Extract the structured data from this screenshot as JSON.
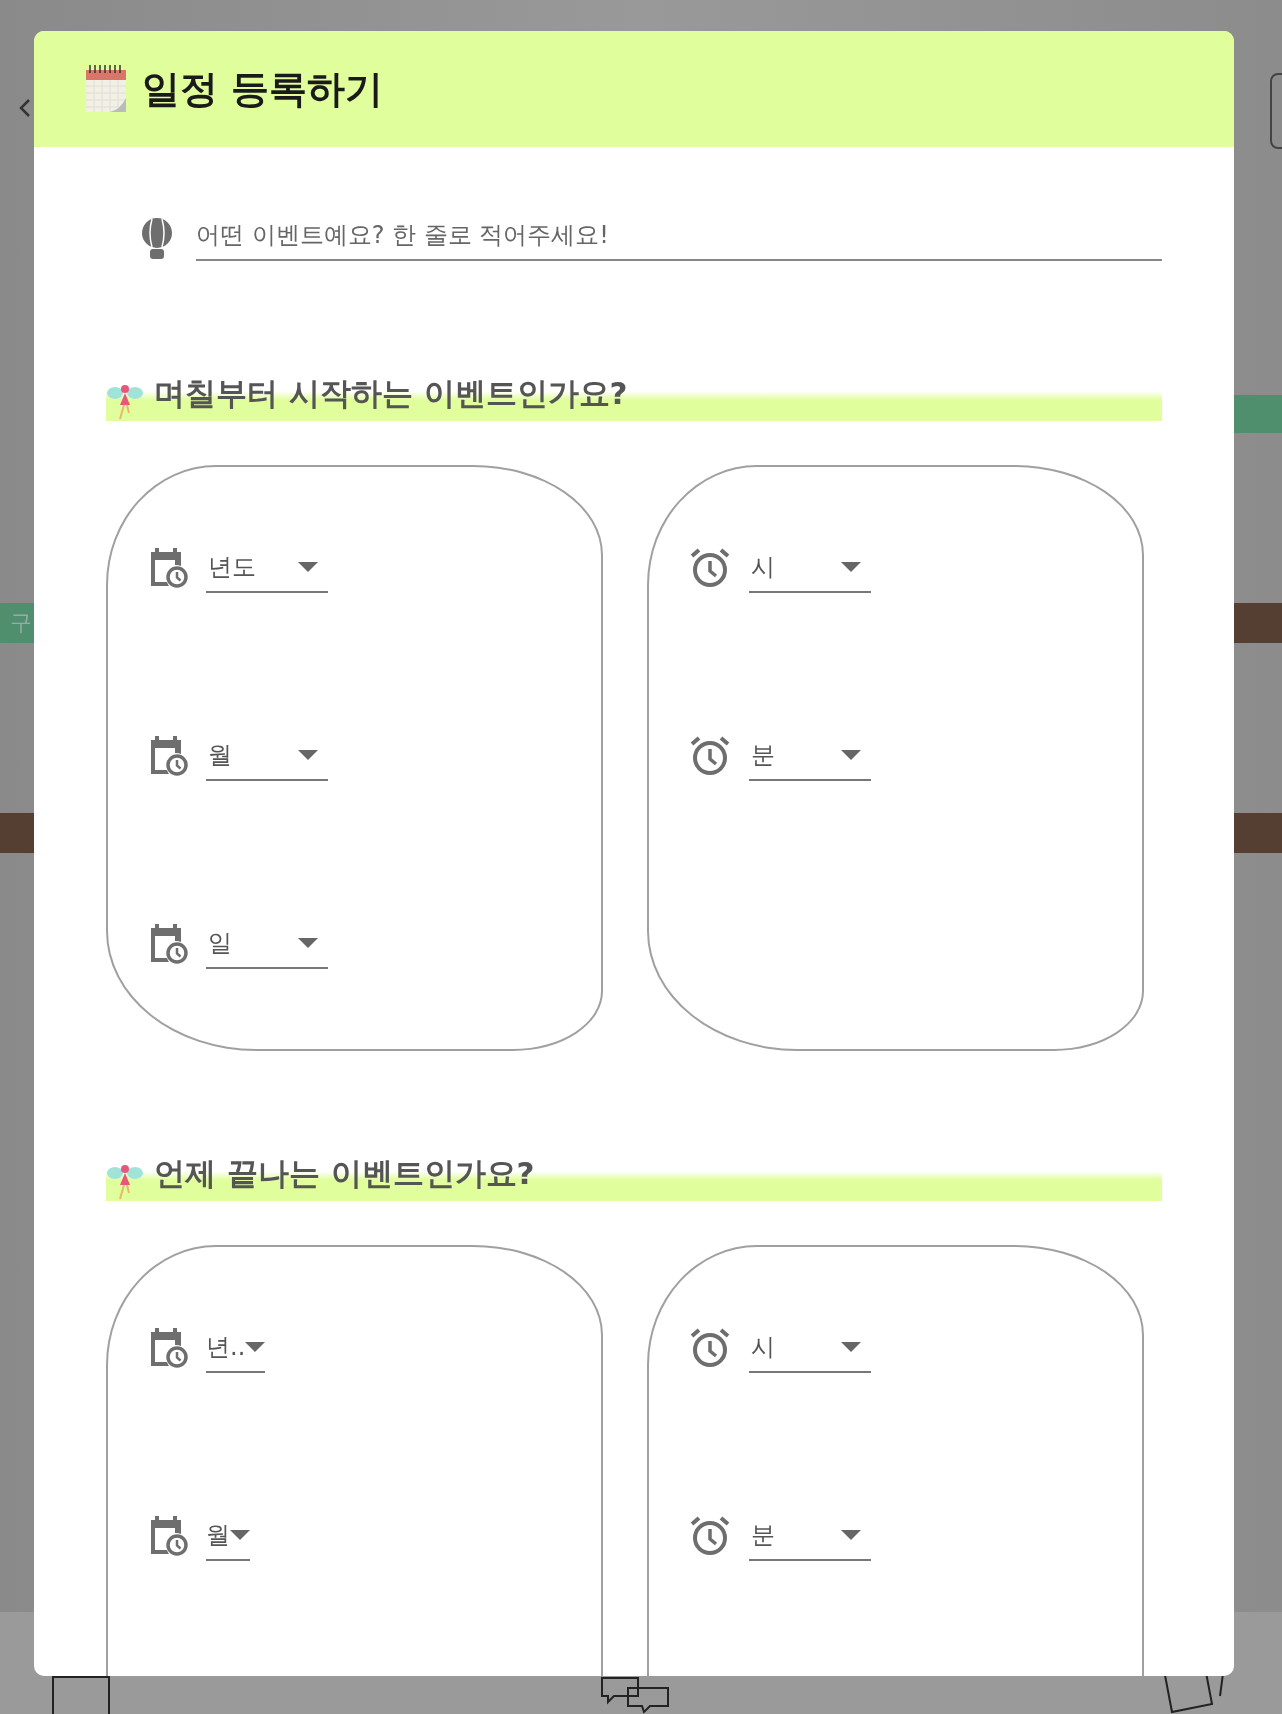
{
  "background_page": {
    "tag_label": "구"
  },
  "dialog": {
    "title": "일정 등록하기",
    "event_input": {
      "placeholder": "어떤 이벤트예요? 한 줄로 적어주세요!"
    },
    "sections": [
      {
        "heading": "며칠부터 시작하는 이벤트인가요?",
        "date_selects": [
          {
            "label": "년도"
          },
          {
            "label": "월"
          },
          {
            "label": "일"
          }
        ],
        "time_selects": [
          {
            "label": "시"
          },
          {
            "label": "분"
          }
        ],
        "narrow_dates": false
      },
      {
        "heading": "언제 끝나는 이벤트인가요?",
        "date_selects": [
          {
            "label": "년.."
          },
          {
            "label": "월"
          }
        ],
        "time_selects": [
          {
            "label": "시"
          },
          {
            "label": "분"
          }
        ],
        "narrow_dates": true
      }
    ]
  }
}
